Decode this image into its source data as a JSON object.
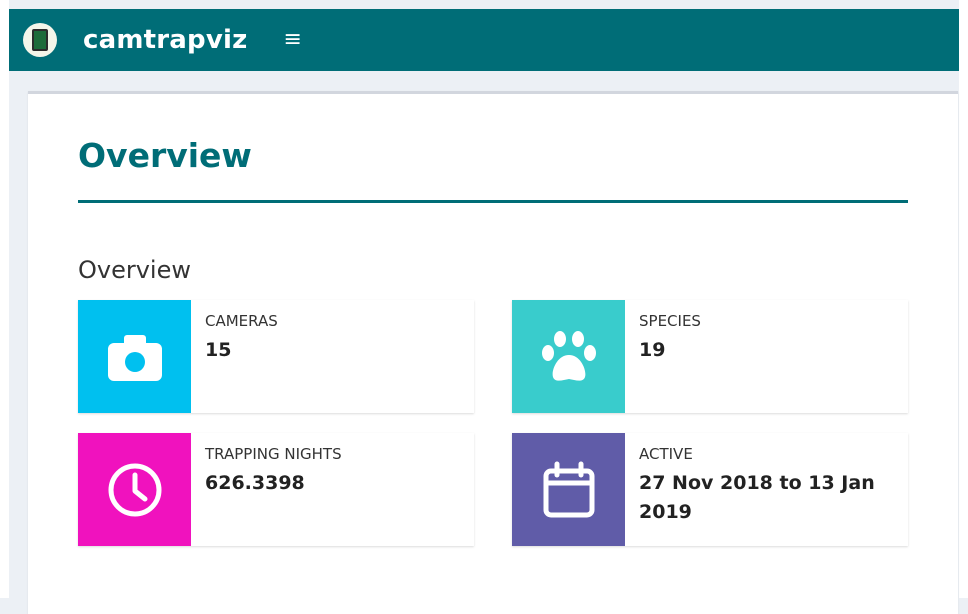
{
  "app": {
    "brand": "camtrapviz",
    "menu_icon": "hamburger-icon"
  },
  "page": {
    "title": "Overview"
  },
  "section": {
    "title": "Overview"
  },
  "info_boxes": [
    {
      "label": "CAMERAS",
      "value": "15",
      "icon": "camera-icon",
      "color": "#00c0ef"
    },
    {
      "label": "SPECIES",
      "value": "19",
      "icon": "paw-icon",
      "color": "#39cccc"
    },
    {
      "label": "TRAPPING NIGHTS",
      "value": "626.3398",
      "icon": "clock-icon",
      "color": "#f012be"
    },
    {
      "label": "ACTIVE",
      "value": "27 Nov 2018 to 13 Jan 2019",
      "icon": "calendar-icon",
      "color": "#605ca8"
    }
  ],
  "colors": {
    "header": "#006d77",
    "accent": "#006d77"
  }
}
